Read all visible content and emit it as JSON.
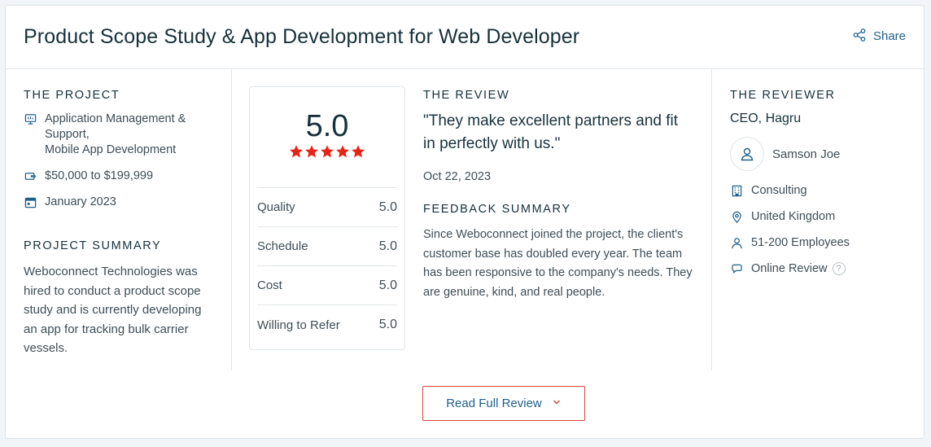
{
  "header": {
    "title": "Product Scope Study & App Development for Web Developer",
    "share_label": "Share"
  },
  "project": {
    "label": "THE PROJECT",
    "services_line1": "Application Management &",
    "services_line2": "Support,",
    "services_line3": "Mobile App Development",
    "budget": "$50,000 to $199,999",
    "date": "January 2023",
    "summary_label": "PROJECT SUMMARY",
    "summary_text": "Weboconnect Technologies was hired to conduct a product scope study and is currently developing an app for tracking bulk carrier vessels."
  },
  "rating": {
    "score": "5.0",
    "stars": 5,
    "rows": [
      {
        "label": "Quality",
        "value": "5.0"
      },
      {
        "label": "Schedule",
        "value": "5.0"
      },
      {
        "label": "Cost",
        "value": "5.0"
      },
      {
        "label": "Willing to Refer",
        "value": "5.0"
      }
    ]
  },
  "review": {
    "label": "THE REVIEW",
    "quote": "\"They make excellent partners and fit in perfectly with us.\"",
    "date": "Oct 22, 2023",
    "feedback_label": "FEEDBACK SUMMARY",
    "feedback_text": "Since Weboconnect joined the project, the client's customer base has doubled every year. The team has been responsive to the company's needs. They are genuine, kind, and real people."
  },
  "reviewer": {
    "label": "THE REVIEWER",
    "role": "CEO, Hagru",
    "name": "Samson Joe",
    "industry": "Consulting",
    "location": "United Kingdom",
    "size": "51-200 Employees",
    "review_type": "Online Review",
    "help_glyph": "?"
  },
  "footer": {
    "read_full_label": "Read Full Review"
  },
  "colors": {
    "star": "#e62415",
    "accent_border": "#d8473a",
    "link": "#1f5f8a",
    "icon": "#1f5f8a"
  }
}
